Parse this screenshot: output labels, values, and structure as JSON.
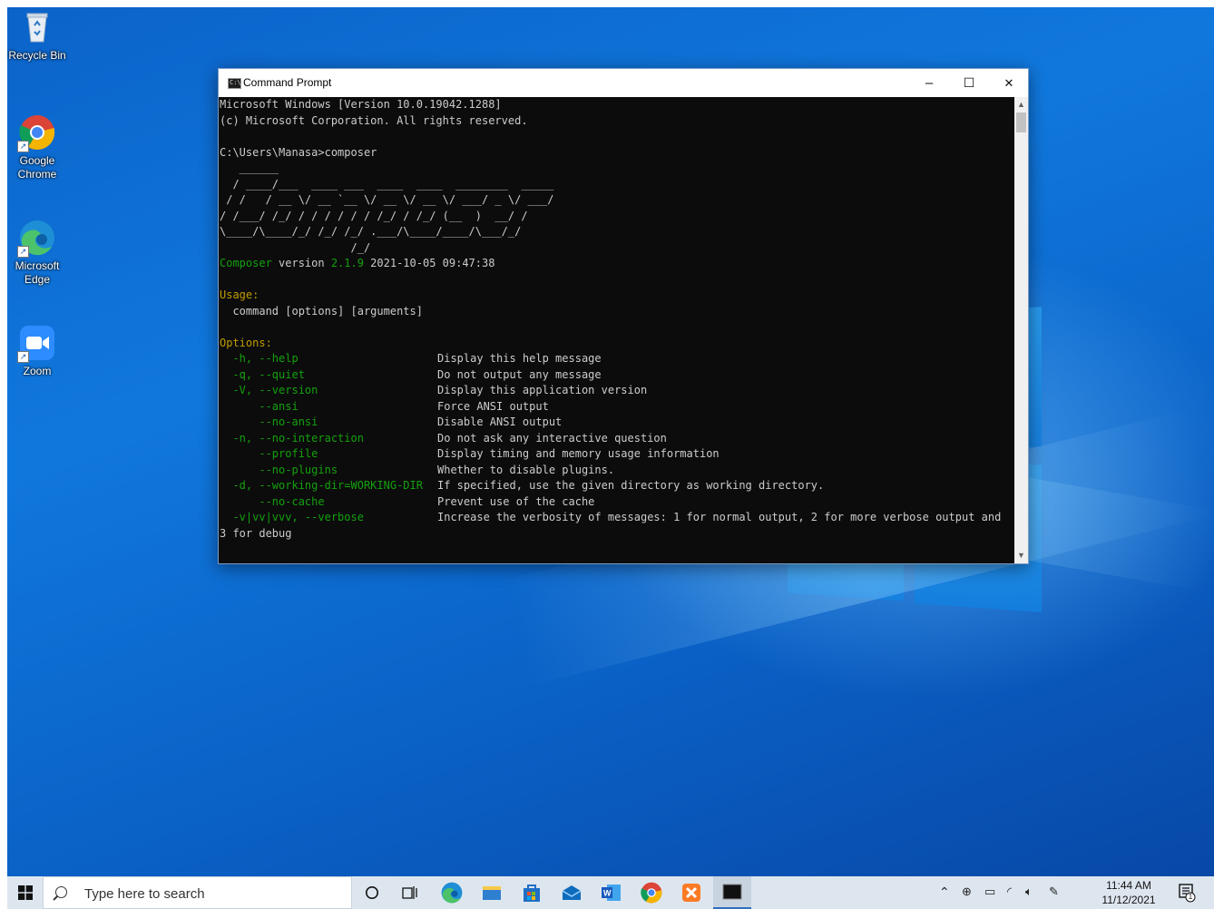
{
  "desktop": {
    "icons": [
      {
        "label": "Recycle Bin"
      },
      {
        "label": "Google Chrome"
      },
      {
        "label": "Microsoft Edge"
      },
      {
        "label": "Zoom"
      }
    ]
  },
  "window": {
    "title": "Command Prompt",
    "minimize": "–",
    "maximize": "☐",
    "close": "✕"
  },
  "terminal": {
    "header1": "Microsoft Windows [Version 10.0.19042.1288]",
    "header2": "(c) Microsoft Corporation. All rights reserved.",
    "prompt": "C:\\Users\\Manasa>composer",
    "banner": [
      "   ______",
      "  / ____/___  ____ ___  ____  ____  ________  _____",
      " / /   / __ \\/ __ `__ \\/ __ \\/ __ \\/ ___/ _ \\/ ___/",
      "/ /___/ /_/ / / / / / / /_/ / /_/ (__  )  __/ /",
      "\\____/\\____/_/ /_/ /_/ .___/\\____/____/\\___/_/",
      "                    /_/"
    ],
    "version_word": "Composer",
    "version_label": " version ",
    "version_number": "2.1.9",
    "version_date": " 2021-10-05 09:47:38",
    "usage_heading": "Usage:",
    "usage_line": "  command [options] [arguments]",
    "options_heading": "Options:",
    "options": [
      {
        "flag": "  -h, --help",
        "desc": "Display this help message"
      },
      {
        "flag": "  -q, --quiet",
        "desc": "Do not output any message"
      },
      {
        "flag": "  -V, --version",
        "desc": "Display this application version"
      },
      {
        "flag": "      --ansi",
        "desc": "Force ANSI output"
      },
      {
        "flag": "      --no-ansi",
        "desc": "Disable ANSI output"
      },
      {
        "flag": "  -n, --no-interaction",
        "desc": "Do not ask any interactive question"
      },
      {
        "flag": "      --profile",
        "desc": "Display timing and memory usage information"
      },
      {
        "flag": "      --no-plugins",
        "desc": "Whether to disable plugins."
      },
      {
        "flag": "  -d, --working-dir=WORKING-DIR",
        "desc": "If specified, use the given directory as working directory."
      },
      {
        "flag": "      --no-cache",
        "desc": "Prevent use of the cache"
      },
      {
        "flag": "  -v|vv|vvv, --verbose",
        "desc": "Increase the verbosity of messages: 1 for normal output, 2 for more verbose output and"
      }
    ],
    "wrap_line": "3 for debug"
  },
  "taskbar": {
    "search_placeholder": "Type here to search",
    "time": "11:44 AM",
    "date": "11/12/2021",
    "notification_count": "1"
  },
  "colors": {
    "yellow": "#c19c00",
    "green": "#13a10e",
    "console_bg": "#0c0c0c",
    "console_fg": "#cccccc"
  }
}
